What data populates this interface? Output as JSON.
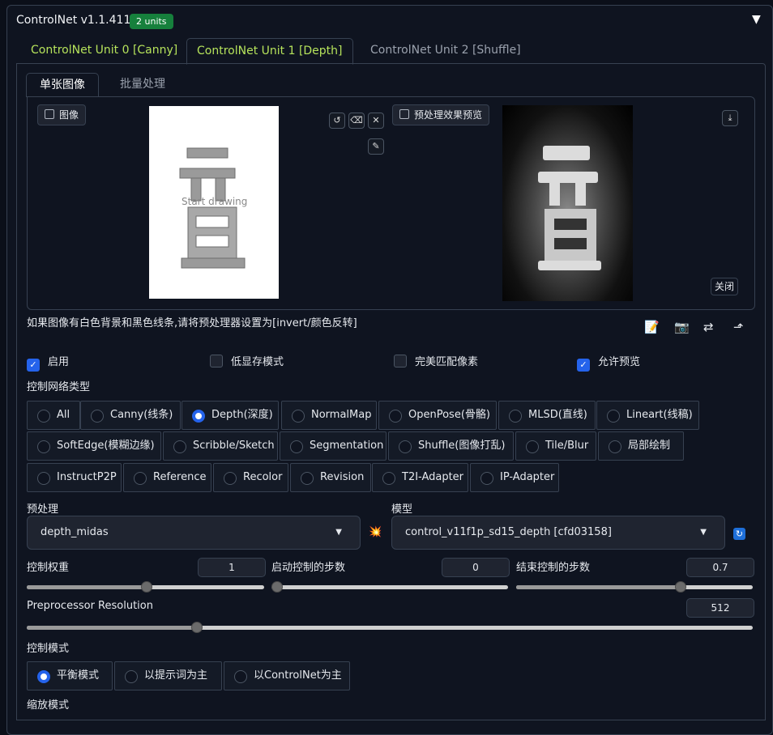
{
  "header": {
    "title": "ControlNet v1.1.411",
    "badge": "2 units",
    "collapse_icon": "▼"
  },
  "unit_tabs": [
    "ControlNet Unit 0 [Canny]",
    "ControlNet Unit 1 [Depth]",
    "ControlNet Unit 2 [Shuffle]"
  ],
  "image_tabs": [
    "单张图像",
    "批量处理"
  ],
  "image_panel": {
    "image_label": "图像",
    "drawing_hint": "Start drawing",
    "preview_label": "预处理效果预览",
    "close_label": "关闭",
    "preview_glyph": "亓\n日\n亘"
  },
  "hint_text": "如果图像有白色背景和黑色线条,请将预处理器设置为[invert/颜色反转]",
  "actions": [
    "📝",
    "📷",
    "⇄",
    "⬏"
  ],
  "checkboxes": [
    {
      "label": "启用",
      "checked": true
    },
    {
      "label": "低显存模式",
      "checked": false
    },
    {
      "label": "完美匹配像素",
      "checked": false
    },
    {
      "label": "允许预览",
      "checked": true
    }
  ],
  "control_type": {
    "label": "控制网络类型",
    "options": [
      "All",
      "Canny(线条)",
      "Depth(深度)",
      "NormalMap",
      "OpenPose(骨骼)",
      "MLSD(直线)",
      "Lineart(线稿)",
      "SoftEdge(模糊边缘)",
      "Scribble/Sketch",
      "Segmentation",
      "Shuffle(图像打乱)",
      "Tile/Blur",
      "局部绘制",
      "InstructP2P",
      "Reference",
      "Recolor",
      "Revision",
      "T2I-Adapter",
      "IP-Adapter"
    ],
    "selected": "Depth(深度)"
  },
  "preprocessor": {
    "label": "预处理",
    "value": "depth_midas"
  },
  "model": {
    "label": "模型",
    "value": "control_v11f1p_sd15_depth [cfd03158]"
  },
  "sliders": {
    "weight": {
      "label": "控制权重",
      "value": "1",
      "fraction": 0.5
    },
    "start": {
      "label": "启动控制的步数",
      "value": "0",
      "fraction": 0.0
    },
    "end": {
      "label": "结束控制的步数",
      "value": "0.7",
      "fraction": 0.7
    },
    "resolution": {
      "label": "Preprocessor Resolution",
      "value": "512",
      "fraction": 0.23
    }
  },
  "control_mode": {
    "label": "控制模式",
    "options": [
      "平衡模式",
      "以提示词为主",
      "以ControlNet为主"
    ],
    "selected": "平衡模式"
  },
  "resize_mode": {
    "label": "缩放模式"
  }
}
